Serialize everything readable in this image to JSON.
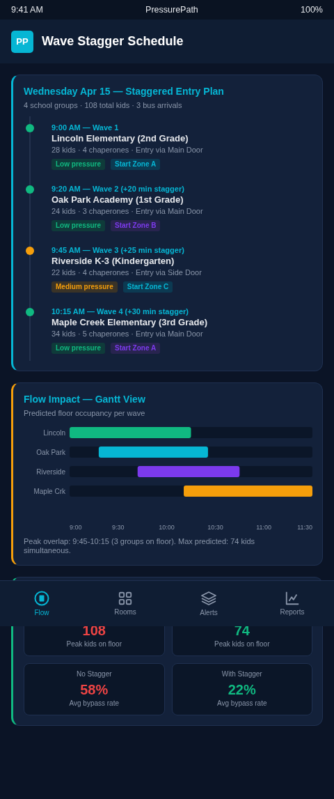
{
  "status_bar": {
    "time": "9:41 AM",
    "app": "PressurePath",
    "battery": "100%"
  },
  "header": {
    "logo": "PP",
    "title": "Wave Stagger Schedule"
  },
  "plan": {
    "title": "Wednesday Apr 15 — Staggered Entry Plan",
    "subtitle": "4 school groups · 108 total kids · 3 bus arrivals",
    "waves": [
      {
        "time": "9:00 AM — Wave 1",
        "name": "Lincoln Elementary (2nd Grade)",
        "meta": "28 kids · 4 chaperones · Entry via Main Door",
        "color": "#10b981",
        "tags": [
          {
            "label": "Low pressure",
            "kind": "low"
          },
          {
            "label": "Start Zone A",
            "kind": "zone"
          }
        ]
      },
      {
        "time": "9:20 AM — Wave 2 (+20 min stagger)",
        "name": "Oak Park Academy (1st Grade)",
        "meta": "24 kids · 3 chaperones · Entry via Main Door",
        "color": "#10b981",
        "tags": [
          {
            "label": "Low pressure",
            "kind": "low"
          },
          {
            "label": "Start Zone B",
            "kind": "altzone"
          }
        ]
      },
      {
        "time": "9:45 AM — Wave 3 (+25 min stagger)",
        "name": "Riverside K-3 (Kindergarten)",
        "meta": "22 kids · 4 chaperones · Entry via Side Door",
        "color": "#f59e0b",
        "tags": [
          {
            "label": "Medium pressure",
            "kind": "medium"
          },
          {
            "label": "Start Zone C",
            "kind": "zone"
          }
        ]
      },
      {
        "time": "10:15 AM — Wave 4 (+30 min stagger)",
        "name": "Maple Creek Elementary (3rd Grade)",
        "meta": "34 kids · 5 chaperones · Entry via Main Door",
        "color": "#10b981",
        "tags": [
          {
            "label": "Low pressure",
            "kind": "low"
          },
          {
            "label": "Start Zone A",
            "kind": "altzone"
          }
        ]
      }
    ]
  },
  "flow": {
    "title": "Flow Impact — Gantt View",
    "subtitle": "Predicted floor occupancy per wave",
    "chart_data": {
      "type": "bar",
      "orientation": "horizontal",
      "categories": [
        "Lincoln",
        "Oak Park",
        "Riverside",
        "Maple Crk"
      ],
      "series": [
        {
          "color": "#10b981",
          "base": [
            9,
            null,
            null,
            null
          ],
          "values": [
            1.25,
            null,
            null,
            null
          ]
        },
        {
          "color": "#06b6d4",
          "base": [
            null,
            9.3,
            null,
            null
          ],
          "values": [
            null,
            1.125,
            null,
            null
          ]
        },
        {
          "color": "#7c3aed",
          "base": [
            null,
            null,
            9.7,
            null
          ],
          "values": [
            null,
            null,
            1.05,
            null
          ]
        },
        {
          "color": "#f59e0b",
          "base": [
            null,
            null,
            null,
            10.175
          ],
          "values": [
            null,
            null,
            null,
            1.325
          ]
        }
      ],
      "xlim": [
        9,
        11.5
      ],
      "xticks": [
        {
          "value": 9,
          "label": "9:00"
        },
        {
          "value": 9.5,
          "label": "9:30"
        },
        {
          "value": 10,
          "label": "10:00"
        },
        {
          "value": 10.5,
          "label": "10:30"
        },
        {
          "value": 11,
          "label": "11:00"
        },
        {
          "value": 11.5,
          "label": "11:30"
        }
      ]
    },
    "note": "Peak overlap: 9:45-10:15 (3 groups on floor). Max predicted: 74 kids simultaneous."
  },
  "compare": {
    "stats": [
      {
        "value": "108",
        "caption": "Peak kids on floor",
        "color": "#ef4444"
      },
      {
        "value": "74",
        "caption": "Peak kids on floor",
        "color": "#10b981"
      },
      {
        "label": "No Stagger",
        "value": "58%",
        "caption": "Avg bypass rate",
        "color": "#ef4444"
      },
      {
        "label": "With Stagger",
        "value": "22%",
        "caption": "Avg bypass rate",
        "color": "#10b981"
      }
    ]
  },
  "nav": [
    {
      "label": "Flow",
      "selected": true
    },
    {
      "label": "Rooms",
      "selected": false
    },
    {
      "label": "Alerts",
      "selected": false
    },
    {
      "label": "Reports",
      "selected": false
    }
  ]
}
